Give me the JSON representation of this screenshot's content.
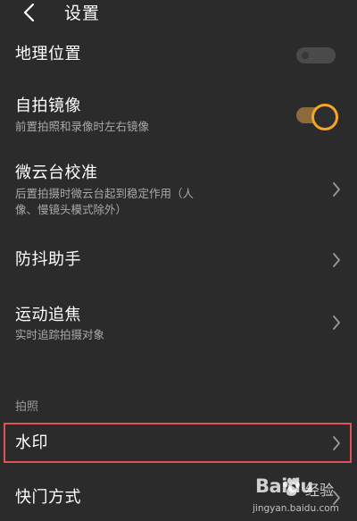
{
  "header": {
    "back_icon": "chevron-left-icon",
    "title": "设置"
  },
  "settings": [
    {
      "title": "地理位置",
      "control": "toggle",
      "enabled": false
    },
    {
      "title": "自拍镜像",
      "subtitle": "前置拍照和录像时左右镜像",
      "control": "toggle",
      "enabled": true
    },
    {
      "title": "微云台校准",
      "subtitle_line1": "后置拍摄时微云台起到稳定作用（人",
      "subtitle_line2": "像、慢镜头模式除外）",
      "control": "chevron"
    },
    {
      "title": "防抖助手",
      "control": "chevron"
    },
    {
      "title": "运动追焦",
      "subtitle": "实时追踪拍摄对象",
      "control": "chevron"
    }
  ],
  "section_photo": {
    "label": "拍照",
    "items": [
      {
        "title": "水印",
        "control": "chevron",
        "highlighted": true
      },
      {
        "title": "快门方式",
        "control": "chevron"
      }
    ]
  },
  "watermark": {
    "logo_text": "Baidu",
    "brand_cn": "经验",
    "url": "jingyan.baidu.com"
  },
  "colors": {
    "background": "#2b2b2b",
    "toggle_accent": "#f5a623",
    "highlight_border": "#e0525a"
  }
}
